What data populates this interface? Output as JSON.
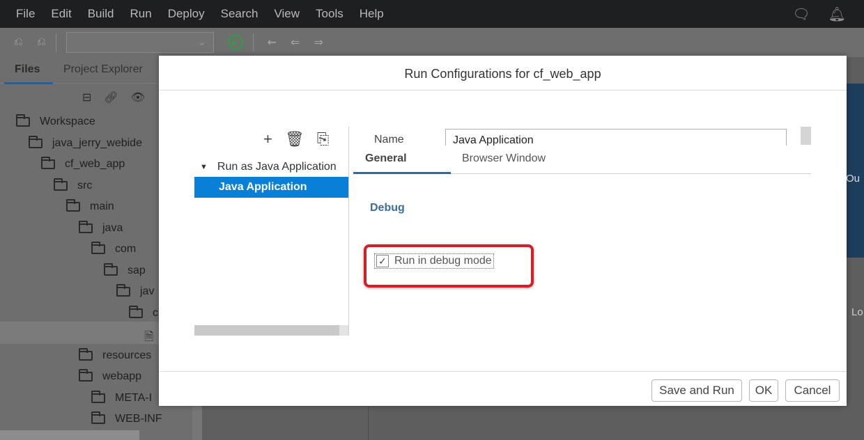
{
  "menubar": {
    "items": [
      "File",
      "Edit",
      "Build",
      "Run",
      "Deploy",
      "Search",
      "View",
      "Tools",
      "Help"
    ],
    "right_icons": [
      "chat-icon",
      "bell-icon"
    ]
  },
  "toolbar": {
    "icons": [
      "undo-icon",
      "redo-icon"
    ],
    "run_config_value": "",
    "nav_icons": [
      "nav-first-icon",
      "nav-back-icon",
      "nav-forward-icon"
    ]
  },
  "left_panel": {
    "tabs": [
      "Files",
      "Project Explorer"
    ],
    "active_tab": "Files",
    "tree": [
      {
        "label": "Workspace",
        "level": 0,
        "icon": "folder-open-icon"
      },
      {
        "label": "java_jerry_webide",
        "level": 1,
        "icon": "folder-open-icon"
      },
      {
        "label": "cf_web_app",
        "level": 2,
        "icon": "folder-open-icon"
      },
      {
        "label": "src",
        "level": 3,
        "icon": "folder-open-icon"
      },
      {
        "label": "main",
        "level": 4,
        "icon": "folder-open-icon"
      },
      {
        "label": "java",
        "level": 5,
        "icon": "folder-open-icon"
      },
      {
        "label": "com",
        "level": 6,
        "icon": "folder-open-icon"
      },
      {
        "label": "sap",
        "level": 7,
        "icon": "folder-open-icon"
      },
      {
        "label": "jav",
        "level": 8,
        "icon": "folder-open-icon"
      },
      {
        "label": "c",
        "level": 9,
        "icon": "folder-open-icon"
      },
      {
        "label": "",
        "level": 10,
        "icon": "file-icon"
      },
      {
        "label": "resources",
        "level": 5,
        "icon": "folder-icon"
      },
      {
        "label": "webapp",
        "level": 5,
        "icon": "folder-open-icon"
      },
      {
        "label": "META-I",
        "level": 6,
        "icon": "folder-plus-icon"
      },
      {
        "label": "WEB-INF",
        "level": 6,
        "icon": "folder-plus-icon"
      }
    ]
  },
  "background": {
    "right_text_1": "Ou",
    "right_text_2": "Lo"
  },
  "dialog": {
    "title": "Run Configurations for cf_web_app",
    "config_group": "Run as Java Application",
    "config_item": "Java Application",
    "name_label": "Name",
    "name_value": "Java Application",
    "tabs": [
      "General",
      "Browser Window"
    ],
    "active_tab": "General",
    "section_heading": "Debug",
    "checkbox_label": "Run in debug mode",
    "checkbox_checked": true,
    "buttons": {
      "save_and_run": "Save and Run",
      "ok": "OK",
      "cancel": "Cancel"
    }
  },
  "colors": {
    "menubar_bg": "#1e1f21",
    "selection_blue": "#0a7fd8",
    "highlight_red": "#d41f26",
    "debug_heading": "#3b6e9c",
    "run_green": "#2f9e3f"
  }
}
